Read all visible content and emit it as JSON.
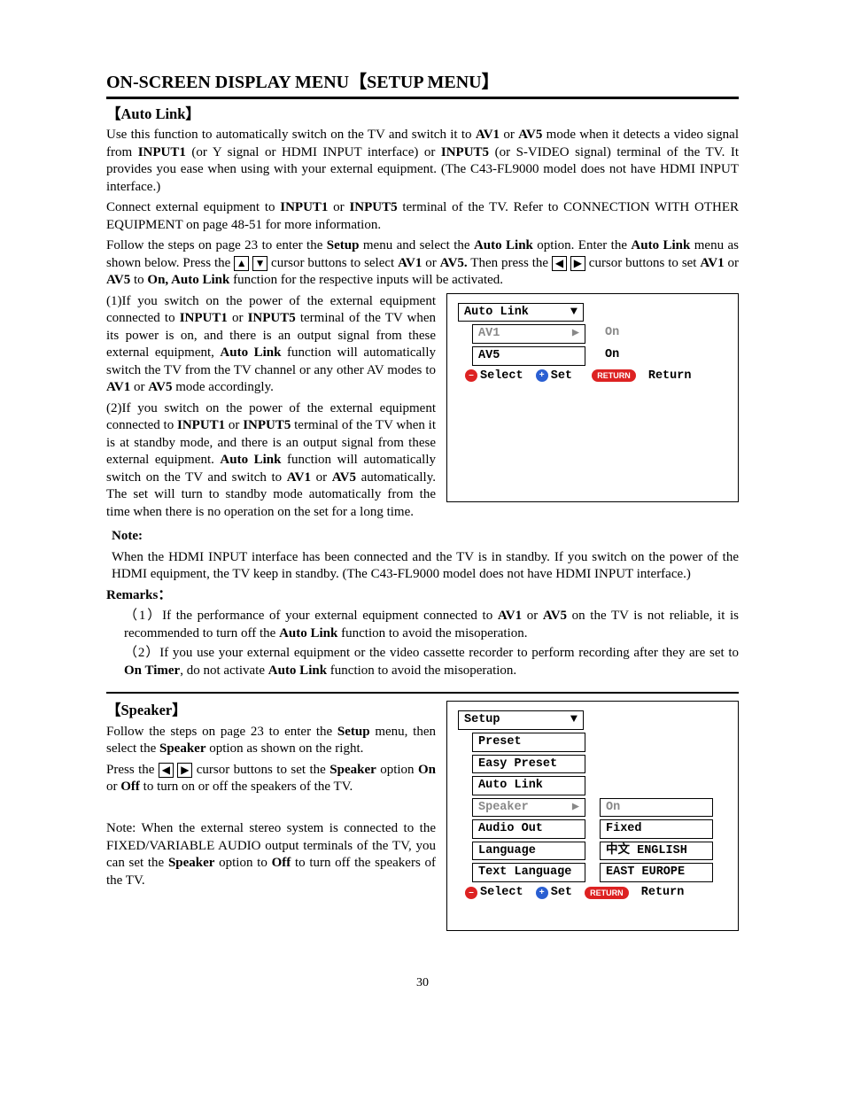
{
  "page_title": "ON-SCREEN DISPLAY MENU【SETUP MENU】",
  "section1": {
    "heading": "【Auto Link】",
    "p1a": "Use this function to automatically switch on the TV and switch it to ",
    "av1": "AV1",
    "p1b": " or ",
    "av5": "AV5",
    "p1c": " mode when it detects a video signal from ",
    "input1": "INPUT1",
    "p1d": " (or Y signal or HDMI INPUT interface) or ",
    "input5": "INPUT5",
    "p1e": " (or S-VIDEO signal) terminal of the TV. It provides you ease when using with your external equipment. (The C43-FL9000 model does not have HDMI INPUT interface.)",
    "p2a": "Connect external equipment to ",
    "p2b": " or ",
    "p2c": " terminal of the TV. Refer to CONNECTION WITH OTHER EQUIPMENT on page 48-51 for more information.",
    "p3a": "Follow the steps on page 23 to enter the ",
    "setup": "Setup",
    "p3b": " menu and select the ",
    "autolink": "Auto Link",
    "p3c": " option. Enter the ",
    "p3d": " menu as shown below. Press the ",
    "p3e": " cursor buttons to select ",
    "p3f": " or ",
    "av5dot": "AV5.",
    "p3g": " Then press the ",
    "p3h": " cursor buttons to set ",
    "p3i": " or ",
    "p3j": " to ",
    "on": "On, Auto Link",
    "p3k": " function for the respective inputs will be activated.",
    "p4a": "(1)If you switch on the power of the external equipment connected to ",
    "p4b": " or ",
    "p4c": " terminal of the TV when its power is on, and there is an output signal from these external equipment, ",
    "p4d": " function will automatically switch the TV from the TV channel or any other AV modes to ",
    "p4e": " or ",
    "p4f": " mode accordingly.",
    "p5a": "(2)If you switch on the power of the external equipment connected to ",
    "p5b": " or ",
    "p5c": " terminal of the TV when it is at standby mode, and there is an output signal from these external equipment. ",
    "p5d": " function will automatically switch on the TV and switch to ",
    "p5e": " or ",
    "p5f": " automatically. The set will turn to standby mode automatically from the time when there is no operation on the set for a long time.",
    "note_label": "Note:",
    "note_text": "When the HDMI INPUT interface has been connected and the TV is in standby. If you switch on the power of the HDMI equipment, the TV keep in standby. (The C43-FL9000 model does not have HDMI INPUT interface.)",
    "remarks_label": "Remarks：",
    "r1a": "（1）If the performance of your external equipment connected to ",
    "r1b": " or ",
    "r1c": " on the TV is not reliable, it is recommended to turn off the ",
    "r1d": " function to avoid the misoperation.",
    "r2a": "（2）If you use your external equipment or the video cassette recorder to perform recording after they are set to ",
    "ontimer": "On Timer",
    "r2b": ", do not activate ",
    "r2c": " function to avoid the misoperation."
  },
  "section2": {
    "heading": "【Speaker】",
    "p1a": "Follow the steps on page 23 to enter the ",
    "p1b": " menu, then select the ",
    "speaker": "Speaker",
    "p1c": " option as shown on the right.",
    "p2a": "Press the ",
    "p2b": " cursor buttons to set the ",
    "p2c": " option ",
    "on": "On",
    "p2d": " or ",
    "off": "Off",
    "p2e": " to turn on or off the speakers of the TV.",
    "p3a": "Note: When the external stereo system is connected to the FIXED/VARIABLE AUDIO output terminals of the TV, you can set the ",
    "p3b": " option to ",
    "p3c": " to turn off the speakers of the TV."
  },
  "osd1": {
    "title": "Auto Link",
    "row1_l": "AV1",
    "row1_r": "On",
    "row2_l": "AV5",
    "row2_r": "On",
    "select": "Select",
    "set": "Set",
    "ret_pill": "RETURN",
    "ret": "Return"
  },
  "osd2": {
    "title": "Setup",
    "items": [
      "Preset",
      "Easy Preset",
      "Auto Link"
    ],
    "sel_l": "Speaker",
    "sel_r": "On",
    "row5_l": "Audio Out",
    "row5_r": "Fixed",
    "row6_l": "Language",
    "row6_r": "中文 ENGLISH",
    "row7_l": "Text Language",
    "row7_r": "EAST EUROPE",
    "select": "Select",
    "set": "Set",
    "ret_pill": "RETURN",
    "ret": "Return"
  },
  "icons": {
    "up": "▲",
    "down": "▼",
    "left": "◀",
    "right": "▶",
    "minus": "–",
    "plus": "+"
  },
  "page_number": "30"
}
